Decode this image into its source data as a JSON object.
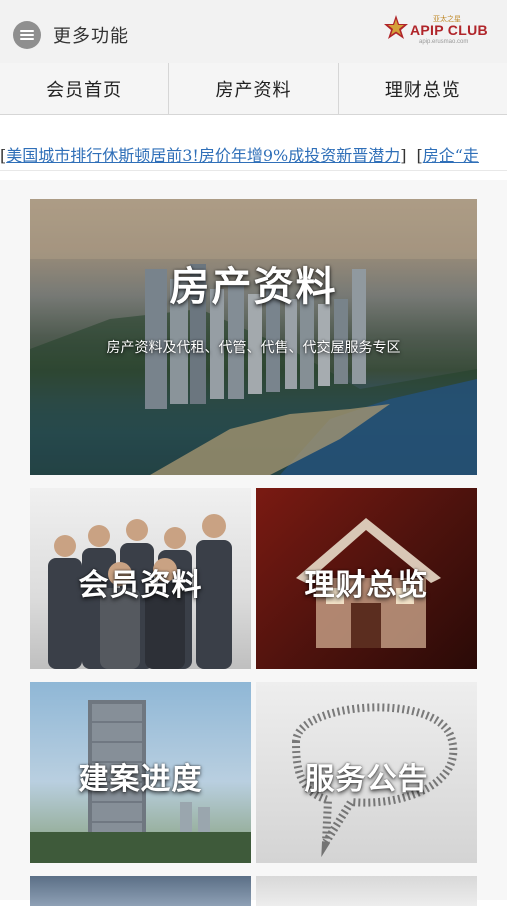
{
  "header": {
    "menu_label": "更多功能",
    "logo": {
      "brand": "APIP CLUB",
      "cn": "亚太之星",
      "url": "apip.erusmao.com"
    }
  },
  "tabs": [
    {
      "label": "会员首页"
    },
    {
      "label": "房产资料"
    },
    {
      "label": "理财总览"
    }
  ],
  "ticker": {
    "items": [
      "美国城市排行休斯顿居前3!房价年增9%成投资新晋潜力",
      "房企“走"
    ]
  },
  "cards": {
    "hero": {
      "title": "房产资料",
      "desc": "房产资料及代租、代管、代售、代交屋服务专区"
    },
    "member": {
      "title": "会员资料"
    },
    "finance": {
      "title": "理财总览"
    },
    "project": {
      "title": "建案进度"
    },
    "notice": {
      "title": "服务公告"
    }
  },
  "colors": {
    "link": "#2f6fb8",
    "logo_red": "#b0252a",
    "logo_gold": "#c08a2b"
  }
}
